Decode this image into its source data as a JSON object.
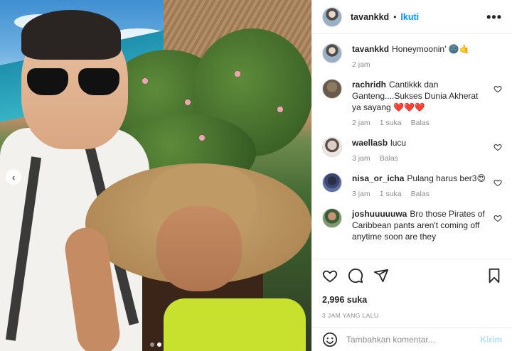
{
  "post": {
    "username": "tavankkd",
    "follow_label": "Ikuti",
    "separator": "•",
    "more_label": "•••"
  },
  "caption": {
    "username": "tavankkd",
    "text": "Honeymoonin’ 🌚🤙",
    "time": "2 jam"
  },
  "comments": [
    {
      "username": "rachridh",
      "text": "Cantikkk dan Ganteng....Sukses Dunia Akherat ya sayang ❤️❤️❤️",
      "time": "2 jam",
      "likes": "1 suka",
      "reply": "Balas"
    },
    {
      "username": "waellasb",
      "text": "lucu",
      "time": "3 jam",
      "likes": "",
      "reply": "Balas"
    },
    {
      "username": "nisa_or_icha",
      "text": "Pulang harus ber3😍",
      "time": "3 jam",
      "likes": "1 suka",
      "reply": "Balas"
    },
    {
      "username": "joshuuuuuwa",
      "text": "Bro those Pirates of Caribbean pants aren't coming off anytime soon are they",
      "time": "",
      "likes": "",
      "reply": ""
    }
  ],
  "actions": {
    "likes_count": "2,996 suka",
    "timestamp": "3 JAM YANG LALU"
  },
  "composer": {
    "placeholder": "Tambahkan komentar...",
    "post_label": "Kirim"
  },
  "carousel": {
    "prev_label": "‹",
    "slide_count": 2,
    "active_slide": 2
  },
  "colors": {
    "accent": "#0095f6",
    "post_disabled": "#b2dffc",
    "muted": "#8e8e8e"
  }
}
